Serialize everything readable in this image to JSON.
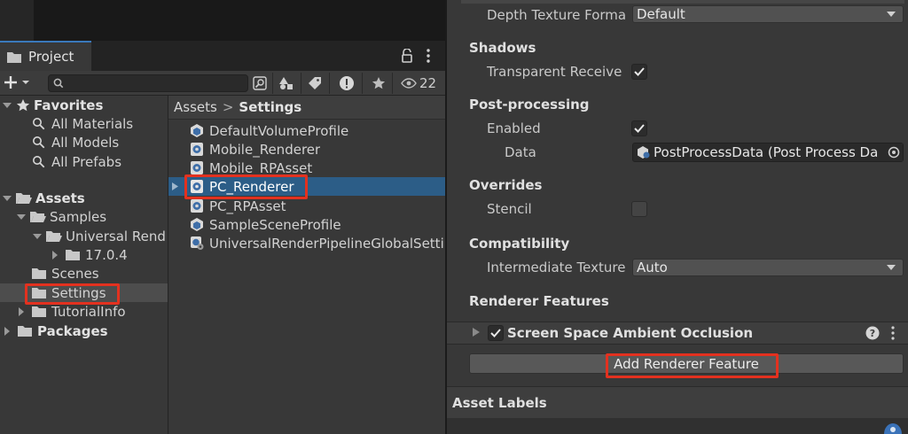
{
  "project_window": {
    "tab_label": "Project",
    "search_placeholder": "",
    "hidden_count": "22",
    "breadcrumb": {
      "root": "Assets",
      "separator": ">",
      "current": "Settings"
    },
    "tree": {
      "favorites_label": "Favorites",
      "favorites": [
        "All Materials",
        "All Models",
        "All Prefabs"
      ],
      "assets_label": "Assets",
      "samples_label": "Samples",
      "universal_label": "Universal Rend",
      "version_label": "17.0.4",
      "scenes_label": "Scenes",
      "settings_label": "Settings",
      "tutorialinfo_label": "TutorialInfo",
      "packages_label": "Packages"
    },
    "files": [
      {
        "name": "DefaultVolumeProfile",
        "icon": "volume-profile-icon"
      },
      {
        "name": "Mobile_Renderer",
        "icon": "renderer-data-icon"
      },
      {
        "name": "Mobile_RPAsset",
        "icon": "pipeline-asset-icon"
      },
      {
        "name": "PC_Renderer",
        "icon": "renderer-data-icon"
      },
      {
        "name": "PC_RPAsset",
        "icon": "pipeline-asset-icon"
      },
      {
        "name": "SampleSceneProfile",
        "icon": "volume-profile-icon"
      },
      {
        "name": "UniversalRenderPipelineGlobalSetti",
        "icon": "global-settings-icon"
      }
    ],
    "selected_file": "PC_Renderer"
  },
  "inspector": {
    "depth_texture_label": "Depth Texture Forma",
    "depth_texture_value": "Default",
    "shadows_header": "Shadows",
    "transparent_receive_label": "Transparent Receive",
    "transparent_receive_checked": true,
    "postprocessing_header": "Post-processing",
    "enabled_label": "Enabled",
    "enabled_checked": true,
    "data_label": "Data",
    "data_value": "PostProcessData (Post Process Da",
    "overrides_header": "Overrides",
    "stencil_label": "Stencil",
    "stencil_checked": false,
    "compatibility_header": "Compatibility",
    "intermediate_texture_label": "Intermediate Texture",
    "intermediate_texture_value": "Auto",
    "renderer_features_header": "Renderer Features",
    "feature_name": "Screen Space Ambient Occlusion",
    "feature_enabled": true,
    "add_feature_button": "Add Renderer Feature",
    "asset_labels_header": "Asset Labels"
  },
  "colors": {
    "highlight": "#e3311f",
    "selection": "#2c5d87",
    "panel": "#383838"
  }
}
